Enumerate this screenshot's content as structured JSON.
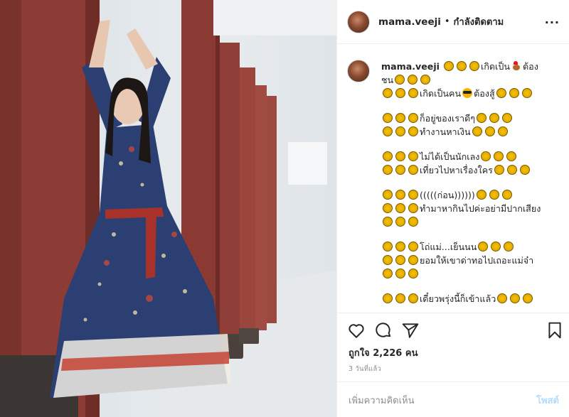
{
  "header": {
    "username": "mama.veeji",
    "separator": "•",
    "follow_status": "กำลังติดตาม",
    "more_label": "···"
  },
  "caption": {
    "username": "mama.veeji",
    "lines": [
      {
        "pre": 3,
        "text": "เกิดเป็น",
        "emoji": "rooster",
        "tail": "ต้อง"
      },
      {
        "pre": 0,
        "text": "ชน",
        "post": 3
      },
      {
        "pre": 3,
        "text": "เกิดเป็นคน",
        "emoji": "glasses",
        "tail": "ต้องสู้",
        "post": 3
      },
      {
        "gap": true
      },
      {
        "pre": 3,
        "text": "ก็อยู่ของเราดีๆ",
        "post": 3
      },
      {
        "pre": 3,
        "text": "ทำงานหาเงิน",
        "post": 3
      },
      {
        "gap": true
      },
      {
        "pre": 3,
        "text": "ไม่ได้เป็นนักเลง",
        "post": 3
      },
      {
        "pre": 3,
        "text": "เที่ยวไปหาเรื่องใคร",
        "post": 3
      },
      {
        "gap": true
      },
      {
        "pre": 3,
        "text": "(((((ก่อน))))))",
        "post": 3
      },
      {
        "pre": 3,
        "text": "ทำมาหากินไปค่ะอย่ามีปากเสียง"
      },
      {
        "pre": 3,
        "text": ""
      },
      {
        "gap": true
      },
      {
        "pre": 3,
        "text": "โถ่แม่...เย็นนน",
        "post": 3
      },
      {
        "pre": 3,
        "text": "ยอมให้เขาด่าทอไปเถอะแม่จ๋า"
      },
      {
        "pre": 3,
        "text": ""
      },
      {
        "gap": true
      },
      {
        "pre": 3,
        "text": "เดี๋ยวพรุ่งนี้ก็เข้าแล้ว",
        "post": 3
      }
    ]
  },
  "actions": {
    "like_icon": "heart-icon",
    "comment_icon": "comment-icon",
    "share_icon": "share-icon",
    "save_icon": "bookmark-icon"
  },
  "likes_text": "ถูกใจ 2,226 คน",
  "timestamp": "3 วันที่แล้ว",
  "comment_box": {
    "placeholder": "เพิ่มความคิดเห็น",
    "post_label": "โพสต์"
  },
  "colors": {
    "post_button": "#b3dbff",
    "pillar": "#8e3a34",
    "dress": "#2c3f73"
  }
}
